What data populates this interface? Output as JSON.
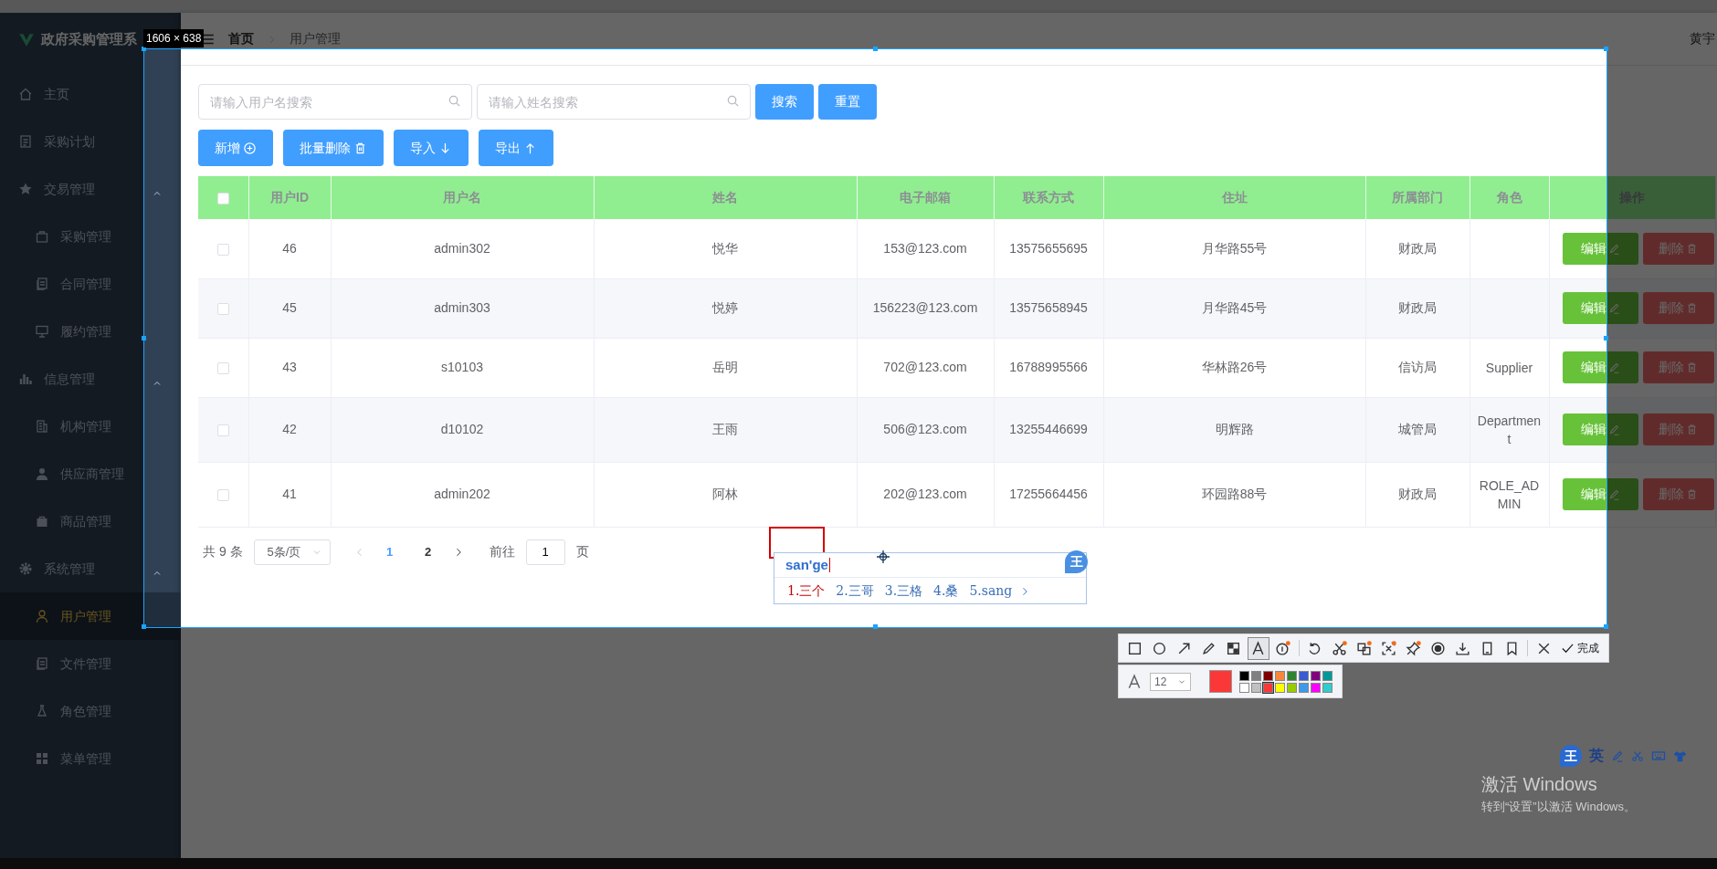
{
  "sidebar": {
    "title": "政府采购管理系",
    "items": [
      {
        "label": "主页",
        "selected": false
      },
      {
        "label": "采购计划",
        "selected": false
      },
      {
        "label": "交易管理",
        "selected": false,
        "expanded": true,
        "children": [
          {
            "label": "采购管理",
            "selected": false
          },
          {
            "label": "合同管理",
            "selected": false
          },
          {
            "label": "履约管理",
            "selected": false
          }
        ]
      },
      {
        "label": "信息管理",
        "selected": false,
        "expanded": true,
        "children": [
          {
            "label": "机构管理",
            "selected": false
          },
          {
            "label": "供应商管理",
            "selected": false
          },
          {
            "label": "商品管理",
            "selected": false
          }
        ]
      },
      {
        "label": "系统管理",
        "selected": false,
        "expanded": true,
        "children": [
          {
            "label": "用户管理",
            "selected": true
          },
          {
            "label": "文件管理",
            "selected": false
          },
          {
            "label": "角色管理",
            "selected": false
          },
          {
            "label": "菜单管理",
            "selected": false
          }
        ]
      }
    ]
  },
  "header": {
    "breadcrumb": [
      "首页",
      "用户管理"
    ],
    "user": "黄宇"
  },
  "search": {
    "fields": [
      {
        "placeholder": "请输入用户名搜索"
      },
      {
        "placeholder": "请输入姓名搜索"
      }
    ],
    "buttons": [
      "搜索",
      "重置"
    ]
  },
  "actions": [
    {
      "label": "新增",
      "kind": "add"
    },
    {
      "label": "批量删除",
      "kind": "delete"
    },
    {
      "label": "导入",
      "kind": "import"
    },
    {
      "label": "导出",
      "kind": "export"
    }
  ],
  "table": {
    "header_checked": false,
    "columns": [
      "用户ID",
      "用户名",
      "姓名",
      "电子邮箱",
      "联系方式",
      "住址",
      "所属部门",
      "角色",
      "操作"
    ],
    "rows": [
      {
        "checked": false,
        "id": "46",
        "username": "admin302",
        "name": "悦华",
        "email": "153@123.com",
        "phone": "13575655695",
        "address": "月华路55号",
        "department": "财政局",
        "edit": "编辑",
        "delete": "删除"
      },
      {
        "checked": false,
        "id": "45",
        "username": "admin303",
        "name": "悦婷",
        "email": "156223@123.com",
        "phone": "13575658945",
        "address": "月华路45号",
        "department": "财政局",
        "edit": "编辑",
        "delete": "删除"
      },
      {
        "checked": false,
        "id": "43",
        "username": "s10103",
        "name": "岳明",
        "email": "702@123.com",
        "phone": "16788995566",
        "address": "华林路26号",
        "department": "信访局",
        "role": "Supplier",
        "edit": "编辑",
        "delete": "删除"
      },
      {
        "checked": false,
        "id": "42",
        "username": "d10102",
        "name": "王雨",
        "email": "506@123.com",
        "phone": "13255446699",
        "address": "明辉路",
        "department": "城管局",
        "role": "Department",
        "edit": "编辑",
        "delete": "删除"
      },
      {
        "checked": false,
        "id": "41",
        "username": "admin202",
        "name": "阿林",
        "email": "202@123.com",
        "phone": "17255664456",
        "address": "环园路88号",
        "department": "财政局",
        "role": "ROLE_ADMIN",
        "edit": "编辑",
        "delete": "删除"
      }
    ]
  },
  "pagination": {
    "total": "共 9 条",
    "page_size": "5条/页",
    "pages": [
      {
        "label": "1",
        "selected": true
      },
      {
        "label": "2",
        "selected": false
      }
    ],
    "goto_label": "前往",
    "goto_value": "1",
    "page_suffix": "页"
  },
  "screenshot_tool": {
    "size_label": "1606 × 638",
    "tools": [
      {
        "kind": "rect",
        "selected": false
      },
      {
        "kind": "ellipse",
        "selected": false
      },
      {
        "kind": "arrow",
        "selected": false
      },
      {
        "kind": "pencil",
        "selected": false
      },
      {
        "kind": "mosaic",
        "selected": false
      },
      {
        "kind": "text",
        "selected": true
      },
      {
        "kind": "step",
        "selected": false,
        "dot": true
      },
      {
        "kind": "sep"
      },
      {
        "kind": "undo",
        "selected": false
      },
      {
        "kind": "scissors",
        "selected": false,
        "dot": true
      },
      {
        "kind": "translate",
        "selected": false,
        "dot": true
      },
      {
        "kind": "scan",
        "selected": false,
        "dot": true
      },
      {
        "kind": "pin",
        "selected": false,
        "dot": true
      },
      {
        "kind": "record",
        "selected": false
      },
      {
        "kind": "download",
        "selected": false
      },
      {
        "kind": "phone",
        "selected": false
      },
      {
        "kind": "bookmark",
        "selected": false
      },
      {
        "kind": "sep"
      },
      {
        "kind": "close",
        "selected": false
      }
    ],
    "done_label": "完成",
    "font_size": "12",
    "palette": [
      {
        "color": "#000000",
        "selected": false
      },
      {
        "color": "#808080",
        "selected": false
      },
      {
        "color": "#800000",
        "selected": false
      },
      {
        "color": "#f7883a",
        "selected": false
      },
      {
        "color": "#308430",
        "selected": false
      },
      {
        "color": "#385ad3",
        "selected": false
      },
      {
        "color": "#800080",
        "selected": false
      },
      {
        "color": "#009999",
        "selected": false
      },
      {
        "color": "#ffffff",
        "selected": false
      },
      {
        "color": "#c0c0c0",
        "selected": false
      },
      {
        "color": "#fb3838",
        "selected": true
      },
      {
        "color": "#ffff00",
        "selected": false
      },
      {
        "color": "#99cc00",
        "selected": false
      },
      {
        "color": "#3d9ae8",
        "selected": false
      },
      {
        "color": "#ff00ff",
        "selected": false
      },
      {
        "color": "#33cccc",
        "selected": false
      }
    ]
  },
  "ime": {
    "logo": "王",
    "composition": "san'ge",
    "candidates": [
      {
        "label": "1.三个",
        "selected": true
      },
      {
        "label": "2.三哥",
        "selected": false
      },
      {
        "label": "3.三格",
        "selected": false
      },
      {
        "label": "4.桑",
        "selected": false
      },
      {
        "label": "5.sang",
        "selected": false
      }
    ]
  },
  "ime_status": {
    "logo": "王",
    "mode": "英"
  },
  "windows_activation": {
    "title": "激活 Windows",
    "subtitle": "转到“设置”以激活 Windows。"
  }
}
